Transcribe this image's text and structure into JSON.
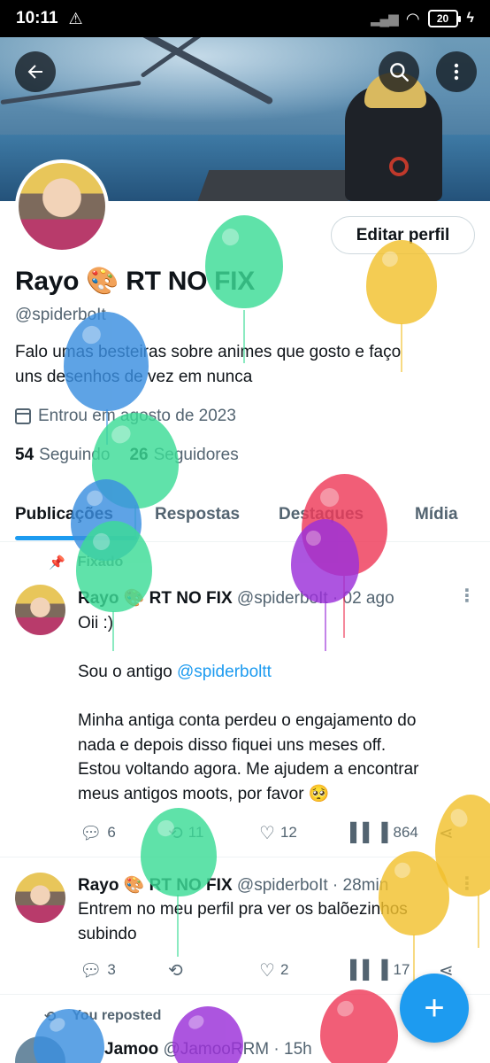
{
  "status_bar": {
    "time": "10:11",
    "battery": "20"
  },
  "profile": {
    "edit_label": "Editar perfil",
    "display_name": "Rayo 🎨 RT NO FIX",
    "handle": "@spiderboIt",
    "bio_line1": "Falo umas besteiras sobre animes que gosto e faço",
    "bio_line2": "uns desenhos de vez em nunca",
    "joined": "Entrou em agosto de 2023",
    "following_count": "54",
    "following_label": "Seguindo",
    "followers_count": "26",
    "followers_label": "Seguidores"
  },
  "tabs": [
    "Publicações",
    "Respostas",
    "Destaques",
    "Mídia"
  ],
  "pinned_label": "Fixado",
  "tweets": [
    {
      "name": "Rayo 🎨 RT NO FIX",
      "meta": "@spiderboIt · 02 ago",
      "line1": "Oii :)",
      "line2_prefix": "Sou o antigo ",
      "line2_link": "@spiderboltt",
      "line3": "Minha antiga conta perdeu o engajamento do",
      "line4": "nada e depois disso fiquei uns meses off.",
      "line5": "Estou voltando agora. Me ajudem a encontrar",
      "line6": "meus antigos moots, por favor 🥺",
      "replies": "6",
      "reposts": "11",
      "likes": "12",
      "views": "864"
    },
    {
      "name": "Rayo 🎨 RT NO FIX",
      "meta": "@spiderboIt · 28min",
      "line1": "Entrem no meu perfil pra ver os balõezinhos",
      "line2": "subindo",
      "replies": "3",
      "likes": "2",
      "views": "17"
    }
  ],
  "repost_label": "You reposted",
  "third_tweet": {
    "name": "Jamoo",
    "meta": "@JamooRRM · 15h"
  },
  "colors": {
    "accent": "#1d9bf0",
    "balloon_green": "#3ddc97",
    "balloon_yellow": "#f2c12e",
    "balloon_blue": "#3b8fe0",
    "balloon_red": "#ef3b5a",
    "balloon_purple": "#9b30d9"
  }
}
